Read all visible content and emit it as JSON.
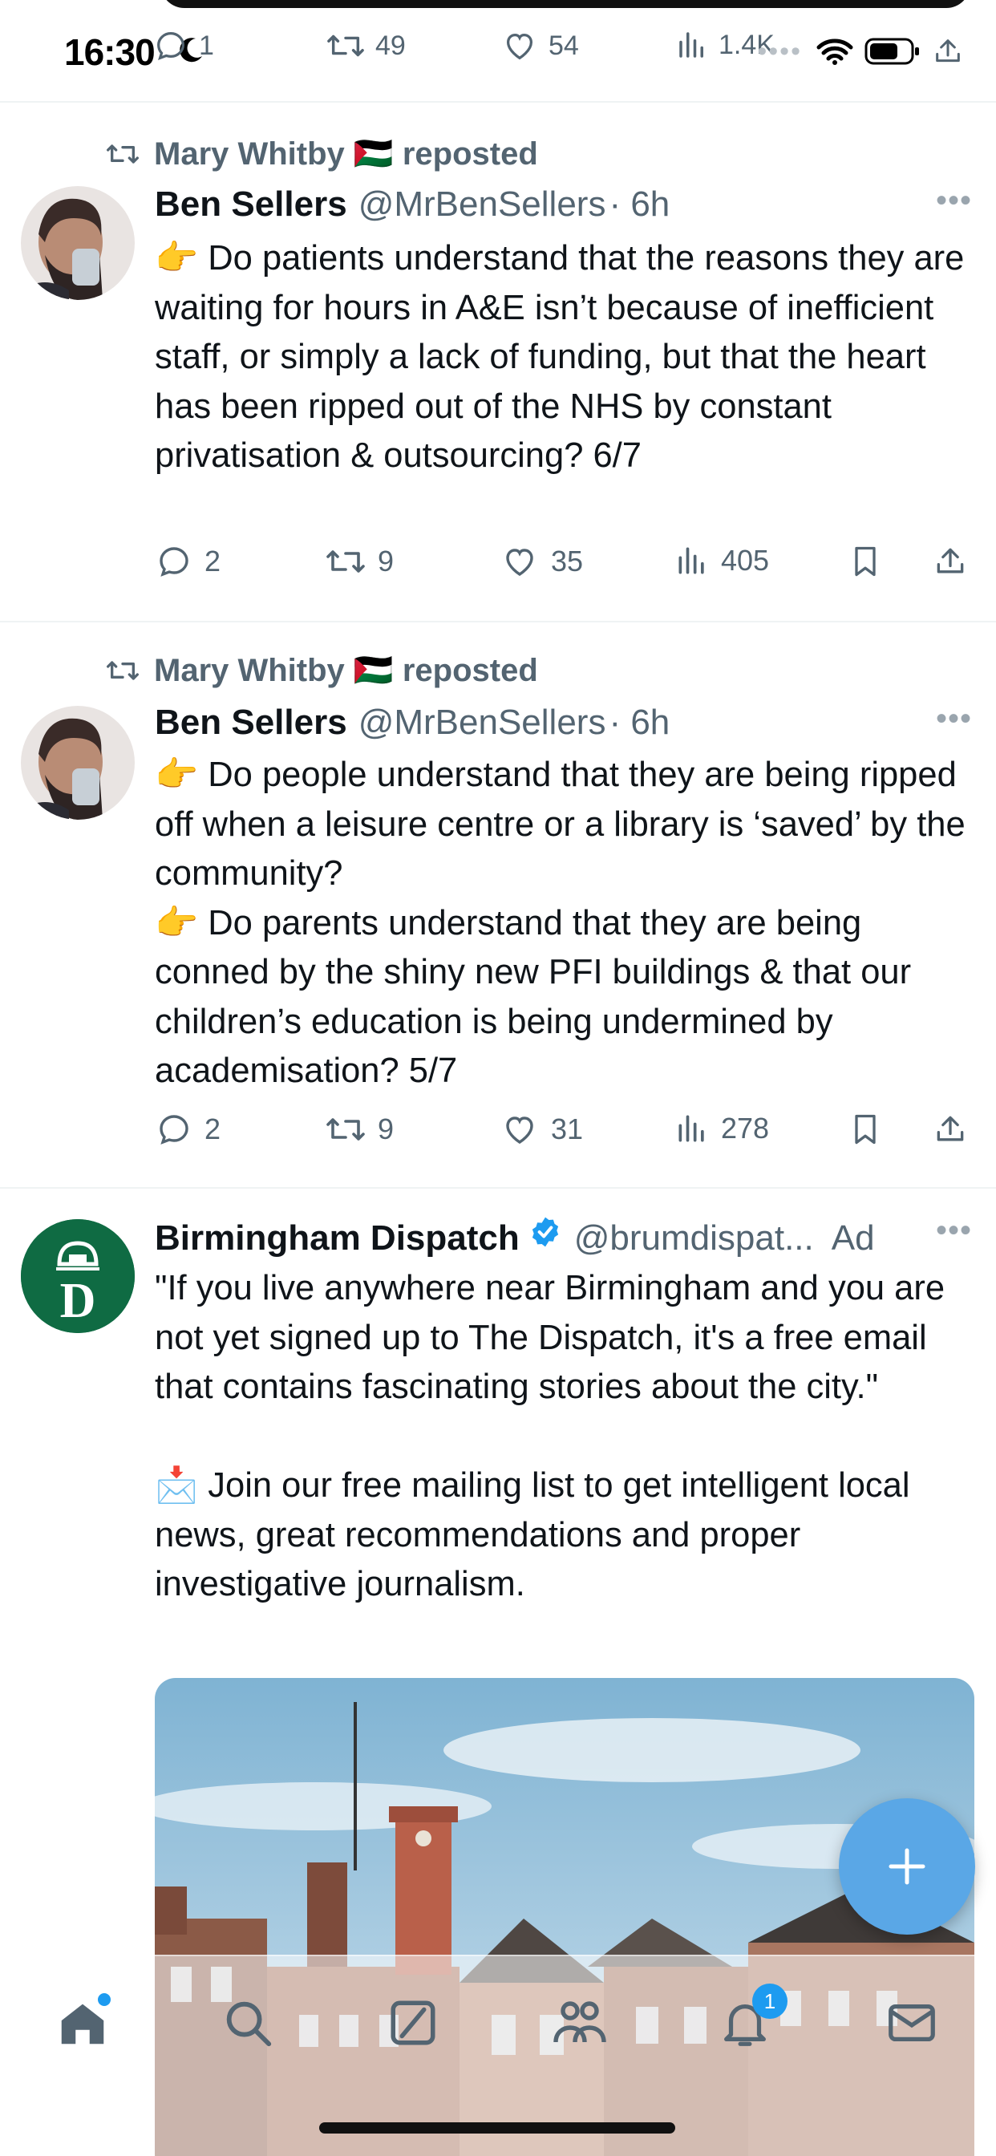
{
  "status_bar": {
    "time": "16:30"
  },
  "top_action_row": {
    "reply_count": "1",
    "repost_count": "49",
    "like_count": "54",
    "view_count": "1.4K"
  },
  "tweets": [
    {
      "reposted_by": "Mary Whitby 🇵🇸 reposted",
      "author_name": "Ben Sellers",
      "author_handle": "@MrBenSellers",
      "time": "· 6h",
      "paragraphs": [
        "👉 Do patients understand that the reasons they are waiting for hours in A&E isn’t because of inefficient staff, or simply a lack of funding, but that the heart has been ripped out of the NHS by constant privatisation & outsourcing? 6/7"
      ],
      "reply_count": "2",
      "repost_count": "9",
      "like_count": "35",
      "view_count": "405"
    },
    {
      "reposted_by": "Mary Whitby 🇵🇸 reposted",
      "author_name": "Ben Sellers",
      "author_handle": "@MrBenSellers",
      "time": "· 6h",
      "paragraphs": [
        "👉 Do people understand that they are being ripped off when a leisure centre or a library is ‘saved’ by the community?",
        "👉 Do parents understand that they are being conned by the shiny new PFI buildings & that our children’s education is being undermined by academisation? 5/7"
      ],
      "reply_count": "2",
      "repost_count": "9",
      "like_count": "31",
      "view_count": "278"
    }
  ],
  "ad": {
    "author_name": "Birmingham Dispatch",
    "author_handle": "@brumdispat...",
    "ad_label": "Ad",
    "avatar_letter": "D",
    "paragraphs": [
      "\"If you live anywhere near Birmingham and you are not yet signed up to The Dispatch, it's a free email that contains fascinating stories about the city.\"",
      "📩 Join our free mailing list to get intelligent local news, great recommendations and proper investigative journalism."
    ]
  },
  "bottom_nav": {
    "notification_badge": "1"
  },
  "colors": {
    "accent": "#1d9bf0",
    "muted": "#536471",
    "ad_avatar_green": "#0f6b43",
    "fab": "#5aa7e6"
  },
  "icons": [
    "reply-icon",
    "repost-icon",
    "like-icon",
    "views-icon",
    "bookmark-icon",
    "share-icon",
    "more-icon",
    "verified-icon",
    "home-icon",
    "search-icon",
    "grok-icon",
    "communities-icon",
    "notifications-icon",
    "messages-icon",
    "compose-plus-icon"
  ]
}
